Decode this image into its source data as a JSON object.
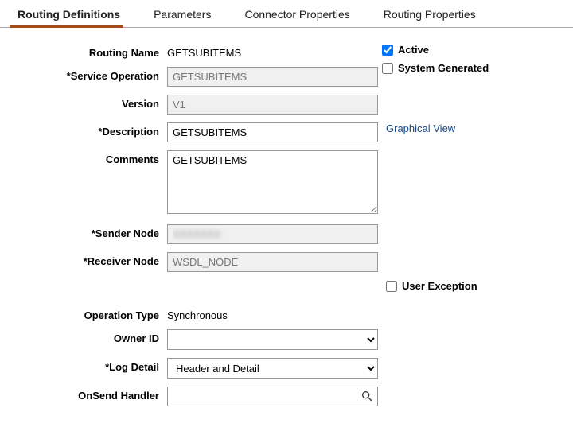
{
  "tabs": {
    "routing_definitions": "Routing Definitions",
    "parameters": "Parameters",
    "connector_properties": "Connector Properties",
    "routing_properties": "Routing Properties"
  },
  "labels": {
    "routing_name": "Routing Name",
    "service_operation": "*Service Operation",
    "version": "Version",
    "description": "*Description",
    "comments": "Comments",
    "sender_node": "*Sender Node",
    "receiver_node": "*Receiver Node",
    "operation_type": "Operation Type",
    "owner_id": "Owner ID",
    "log_detail": "*Log Detail",
    "onsend_handler": "OnSend Handler",
    "active": "Active",
    "system_generated": "System Generated",
    "graphical_view": "Graphical View",
    "user_exception": "User Exception"
  },
  "values": {
    "routing_name": "GETSUBITEMS",
    "service_operation": "GETSUBITEMS",
    "version": "V1",
    "description": "GETSUBITEMS",
    "comments": "GETSUBITEMS",
    "sender_node": "",
    "receiver_node": "WSDL_NODE",
    "operation_type": "Synchronous",
    "active": true,
    "system_generated": false,
    "user_exception": false
  },
  "selects": {
    "owner_id": {
      "selected": "",
      "options": [
        ""
      ]
    },
    "log_detail": {
      "selected": "Header and Detail",
      "options": [
        "Header and Detail"
      ]
    }
  }
}
